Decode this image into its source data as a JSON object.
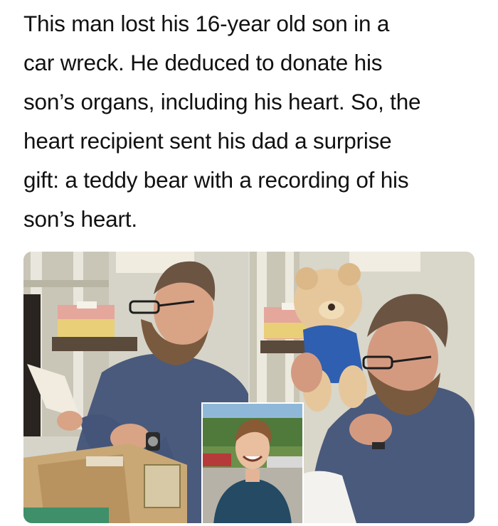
{
  "caption": {
    "lines": [
      "This man lost his 16-year old son in a",
      "car wreck. He deduced to donate his",
      "son’s organs, including his heart. So, the",
      "heart recipient sent his dad a surprise",
      "gift: a teddy bear with a recording of his",
      "son’s heart."
    ]
  },
  "photos": {
    "left": {
      "subject": "man-opening-box-reading-card"
    },
    "right": {
      "subject": "man-hugging-teddy-bear"
    },
    "inset": {
      "subject": "smiling-teenage-son-portrait"
    }
  },
  "colors": {
    "text": "#111111",
    "shirt": "#4a5a7c",
    "beard": "#7a5a3e",
    "wall": "#d8d6cc",
    "box": "#c9a876",
    "bear": "#e6c79c",
    "bear_shirt": "#2f5fb0"
  }
}
